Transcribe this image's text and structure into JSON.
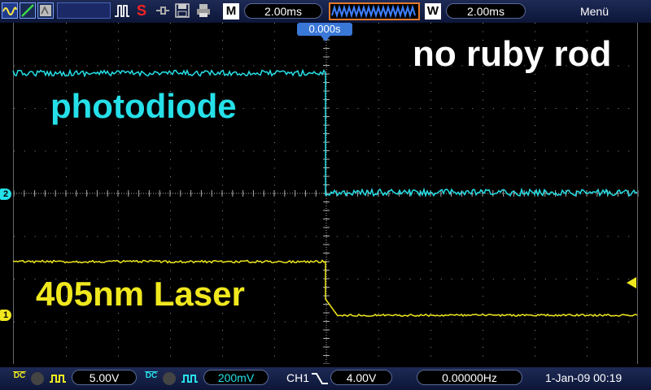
{
  "toolbar": {
    "timebase_m": "2.00ms",
    "timebase_w": "2.00ms",
    "m_label": "M",
    "w_label": "W",
    "menu_label": "Menü",
    "s_label": "S"
  },
  "trigger_time": "0.000s",
  "annotations": {
    "top_right": "no ruby rod",
    "photodiode": "photodiode",
    "laser": "405nm Laser"
  },
  "markers": {
    "ch1": "1",
    "ch2": "2"
  },
  "bottom": {
    "ch1_coupling": "DC",
    "ch1_scale": "5.00V",
    "ch2_coupling": "DC",
    "ch2_scale": "200mV",
    "trigger_source": "CH1",
    "trigger_level": "4.00V",
    "frequency": "0.00000Hz",
    "datetime": "1-Jan-09 00:19"
  },
  "colors": {
    "ch1": "#f0e81e",
    "ch2": "#25e0e8",
    "grid": "#8a8a8a",
    "accent": "#4aa3ff"
  }
}
